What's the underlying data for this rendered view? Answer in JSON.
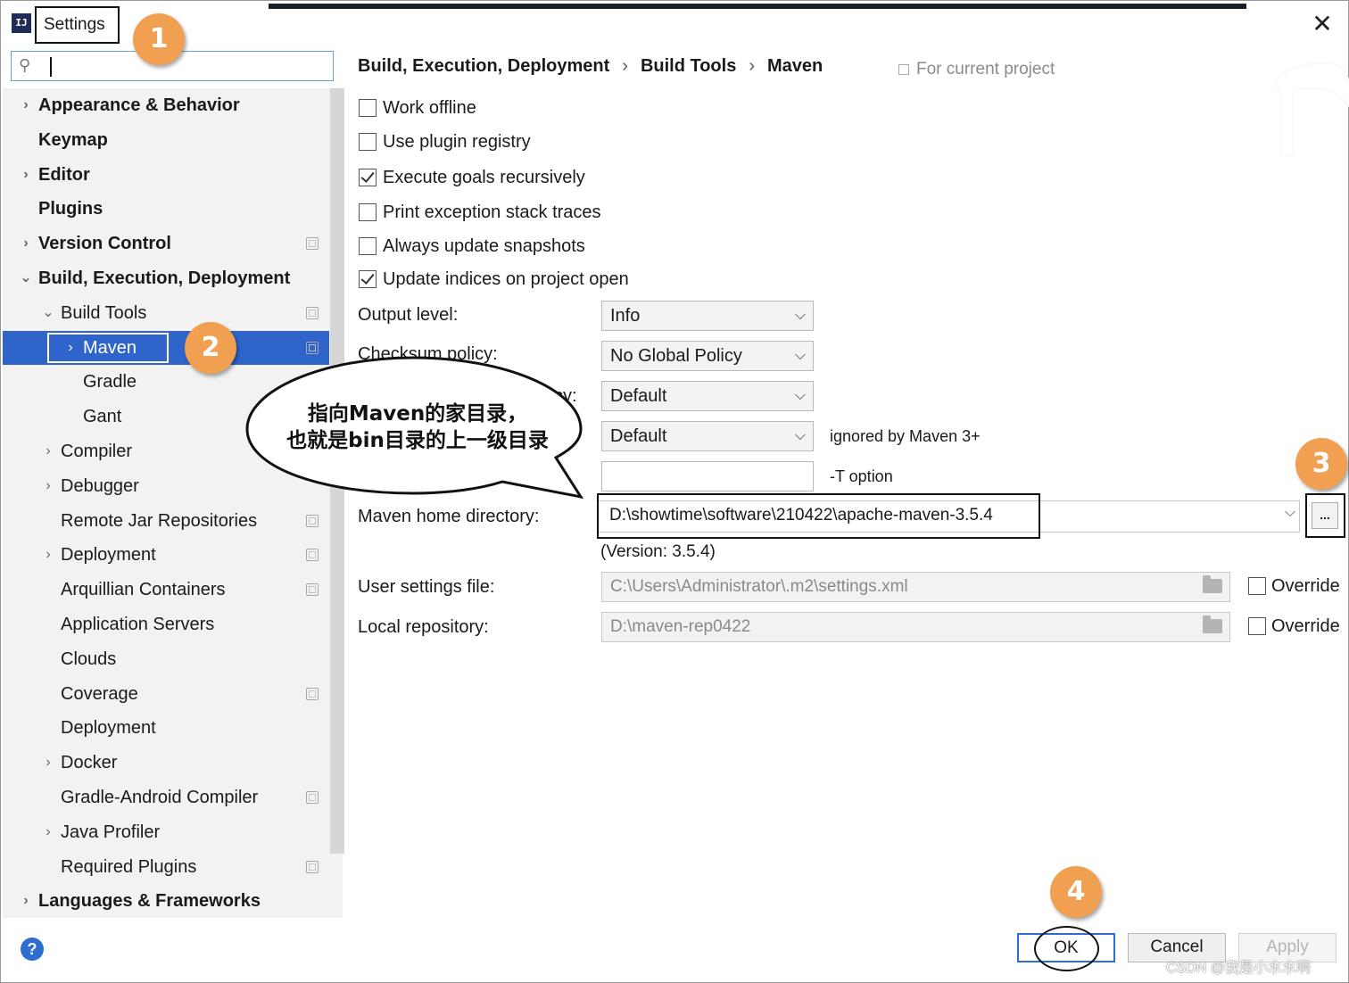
{
  "window": {
    "title": "Settings",
    "app_icon": "IJ"
  },
  "search": {
    "value": "",
    "placeholder": ""
  },
  "sidebar": {
    "items": [
      {
        "label": "Appearance & Behavior",
        "bold": true,
        "arrow": "›",
        "has_cfg": false
      },
      {
        "label": "Keymap",
        "bold": true,
        "arrow": "",
        "has_cfg": false
      },
      {
        "label": "Editor",
        "bold": true,
        "arrow": "›",
        "has_cfg": false
      },
      {
        "label": "Plugins",
        "bold": true,
        "arrow": "",
        "has_cfg": false
      },
      {
        "label": "Version Control",
        "bold": true,
        "arrow": "›",
        "has_cfg": true
      },
      {
        "label": "Build, Execution, Deployment",
        "bold": true,
        "arrow": "⌄",
        "has_cfg": false
      },
      {
        "label": "Build Tools",
        "bold": false,
        "arrow": "⌄",
        "has_cfg": true
      },
      {
        "label": "Maven",
        "bold": false,
        "arrow": "›",
        "has_cfg": true,
        "selected": true
      },
      {
        "label": "Gradle",
        "bold": false,
        "arrow": "",
        "has_cfg": true
      },
      {
        "label": "Gant",
        "bold": false,
        "arrow": "",
        "has_cfg": false
      },
      {
        "label": "Compiler",
        "bold": false,
        "arrow": "›",
        "has_cfg": false
      },
      {
        "label": "Debugger",
        "bold": false,
        "arrow": "›",
        "has_cfg": false
      },
      {
        "label": "Remote Jar Repositories",
        "bold": false,
        "arrow": "",
        "has_cfg": true
      },
      {
        "label": "Deployment",
        "bold": false,
        "arrow": "›",
        "has_cfg": true
      },
      {
        "label": "Arquillian Containers",
        "bold": false,
        "arrow": "",
        "has_cfg": true
      },
      {
        "label": "Application Servers",
        "bold": false,
        "arrow": "",
        "has_cfg": false
      },
      {
        "label": "Clouds",
        "bold": false,
        "arrow": "",
        "has_cfg": false
      },
      {
        "label": "Coverage",
        "bold": false,
        "arrow": "",
        "has_cfg": true
      },
      {
        "label": "Deployment",
        "bold": false,
        "arrow": "",
        "has_cfg": false
      },
      {
        "label": "Docker",
        "bold": false,
        "arrow": "›",
        "has_cfg": false
      },
      {
        "label": "Gradle-Android Compiler",
        "bold": false,
        "arrow": "",
        "has_cfg": true
      },
      {
        "label": "Java Profiler",
        "bold": false,
        "arrow": "›",
        "has_cfg": false
      },
      {
        "label": "Required Plugins",
        "bold": false,
        "arrow": "",
        "has_cfg": true
      },
      {
        "label": "Languages & Frameworks",
        "bold": true,
        "arrow": "›",
        "has_cfg": false
      }
    ]
  },
  "breadcrumb": {
    "items": [
      "Build, Execution, Deployment",
      "Build Tools",
      "Maven"
    ],
    "separator": "›",
    "scope": "For current project"
  },
  "maven": {
    "checkboxes": [
      {
        "label": "Work offline",
        "checked": false
      },
      {
        "label": "Use plugin registry",
        "checked": false
      },
      {
        "label": "Execute goals recursively",
        "checked": true
      },
      {
        "label": "Print exception stack traces",
        "checked": false
      },
      {
        "label": "Always update snapshots",
        "checked": false
      },
      {
        "label": "Update indices on project open",
        "checked": true
      }
    ],
    "output_level_label": "Output level:",
    "output_level_value": "Info",
    "checksum_label": "Checksum policy:",
    "checksum_value": "No Global Policy",
    "fail_label_tail": "cy:",
    "fail_value": "Default",
    "plugin_update_value": "Default",
    "plugin_update_hint": "ignored by Maven 3+",
    "threads_value": "",
    "threads_hint": "-T option",
    "home_label": "Maven home directory:",
    "home_value": "D:\\showtime\\software\\210422\\apache-maven-3.5.4",
    "home_browse": "...",
    "version": "(Version: 3.5.4)",
    "user_settings_label": "User settings file:",
    "user_settings_value": "C:\\Users\\Administrator\\.m2\\settings.xml",
    "local_repo_label": "Local repository:",
    "local_repo_value": "D:\\maven-rep0422",
    "override_label": "Override"
  },
  "buttons": {
    "ok": "OK",
    "cancel": "Cancel",
    "apply": "Apply",
    "help": "?"
  },
  "annotations": {
    "markers": [
      "1",
      "2",
      "3",
      "4"
    ],
    "callout_line1": "指向Maven的家目录，",
    "callout_line2": "也就是bin目录的上一级目录",
    "marker_color": "#f0a050"
  },
  "watermark": "CSDN @我是小水水啊",
  "colors": {
    "selection": "#2f65ca",
    "focus": "#2f6ed1"
  }
}
